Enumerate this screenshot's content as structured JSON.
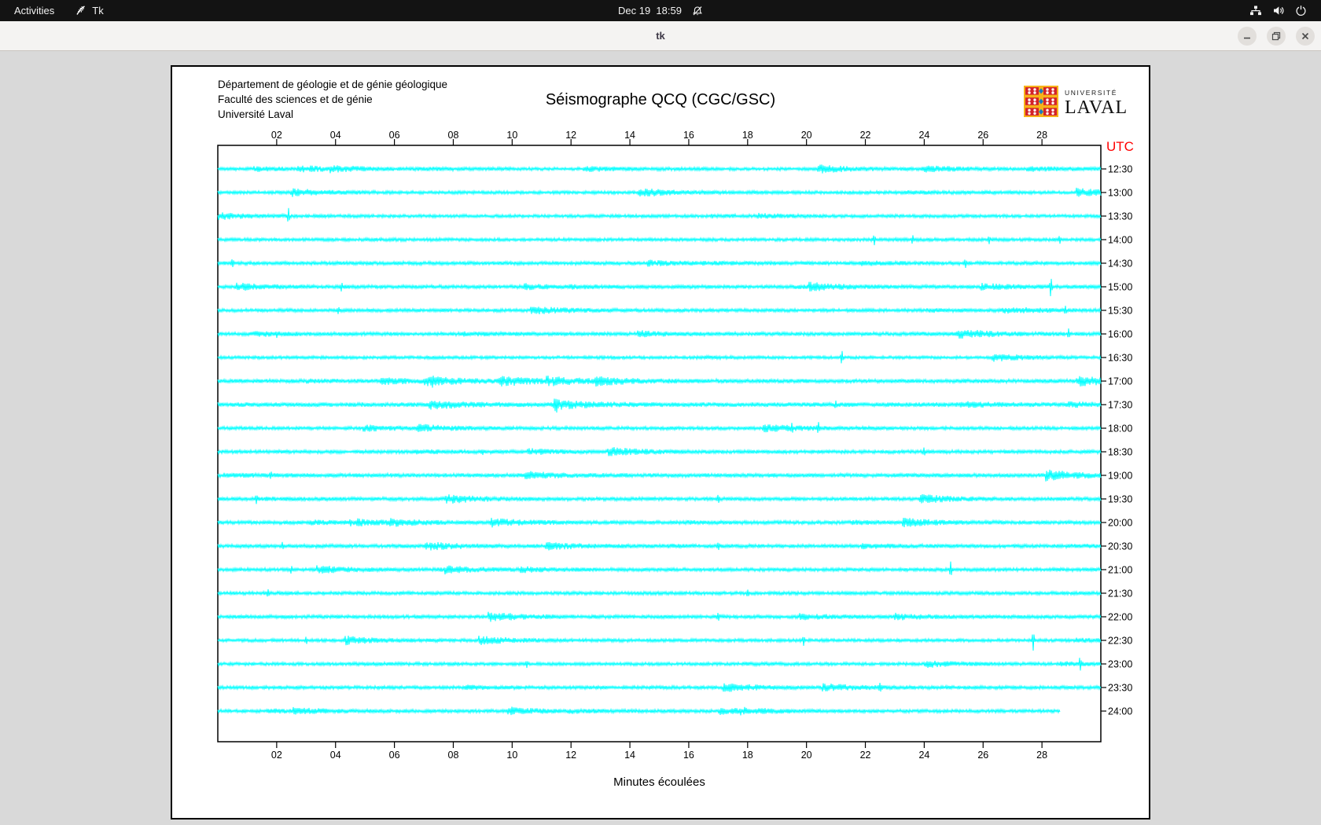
{
  "topbar": {
    "activities": "Activities",
    "app_name": "Tk",
    "clock": "Dec 19  18:59"
  },
  "titlebar": {
    "title": "tk",
    "buttons": [
      "minimize",
      "restore",
      "close"
    ]
  },
  "canvas": {
    "header_lines": [
      "Département de géologie et de génie géologique",
      "Faculté des sciences et de génie",
      "Université Laval"
    ],
    "title": "Séismographe QCQ (CGC/GSC)",
    "logo": {
      "univ": "UNIVERSITÉ",
      "name": "LAVAL",
      "red": "#d2232a",
      "yellow": "#f7b219",
      "blue": "#1f7bbf"
    }
  },
  "chart_data": {
    "type": "line",
    "title": "Séismographe QCQ (CGC/GSC)",
    "xlabel": "Minutes écoulées",
    "ylabel_right": "UTC",
    "x_range": [
      0,
      30
    ],
    "x_ticks": [
      "02",
      "04",
      "06",
      "08",
      "10",
      "12",
      "14",
      "16",
      "18",
      "20",
      "22",
      "24",
      "26",
      "28"
    ],
    "trace_color": "#00ffff",
    "utc_color": "#ff0000",
    "grid": false,
    "rows_note": "each row is a 30-minute helicorder trace labeled with its UTC end time; spikes = [minute, half_amplitude_px]",
    "rows": [
      {
        "label": "12:30",
        "amp": 1.8,
        "end_minute": 30,
        "spikes": []
      },
      {
        "label": "13:00",
        "amp": 1.8,
        "end_minute": 30,
        "spikes": []
      },
      {
        "label": "13:30",
        "amp": 1.8,
        "end_minute": 30,
        "spikes": [
          [
            2.4,
            10
          ]
        ]
      },
      {
        "label": "14:00",
        "amp": 1.8,
        "end_minute": 30,
        "spikes": [
          [
            22.3,
            6
          ],
          [
            23.6,
            5
          ],
          [
            26.2,
            4
          ],
          [
            28.6,
            4
          ]
        ]
      },
      {
        "label": "14:30",
        "amp": 2.0,
        "end_minute": 30,
        "spikes": [
          [
            0.5,
            4
          ],
          [
            25.4,
            5
          ]
        ]
      },
      {
        "label": "15:00",
        "amp": 2.0,
        "end_minute": 30,
        "spikes": [
          [
            4.2,
            4
          ],
          [
            28.3,
            12
          ]
        ]
      },
      {
        "label": "15:30",
        "amp": 1.9,
        "end_minute": 30,
        "spikes": [
          [
            4.1,
            4
          ],
          [
            28.8,
            4
          ]
        ]
      },
      {
        "label": "16:00",
        "amp": 2.0,
        "end_minute": 30,
        "spikes": [
          [
            2.0,
            3
          ],
          [
            28.9,
            5
          ]
        ]
      },
      {
        "label": "16:30",
        "amp": 1.7,
        "end_minute": 30,
        "spikes": [
          [
            21.2,
            8
          ]
        ]
      },
      {
        "label": "17:00",
        "amp": 2.2,
        "end_minute": 30,
        "spikes": [
          [
            7.3,
            4
          ]
        ]
      },
      {
        "label": "17:30",
        "amp": 2.4,
        "end_minute": 30,
        "spikes": [
          [
            11.5,
            4
          ],
          [
            21.0,
            4
          ]
        ]
      },
      {
        "label": "18:00",
        "amp": 1.9,
        "end_minute": 30,
        "spikes": [
          [
            19.5,
            4
          ],
          [
            20.4,
            6
          ]
        ]
      },
      {
        "label": "18:30",
        "amp": 2.0,
        "end_minute": 30,
        "spikes": [
          [
            9.0,
            3
          ],
          [
            24.0,
            4
          ]
        ]
      },
      {
        "label": "19:00",
        "amp": 2.2,
        "end_minute": 30,
        "spikes": [
          [
            1.8,
            4
          ]
        ]
      },
      {
        "label": "19:30",
        "amp": 2.0,
        "end_minute": 30,
        "spikes": [
          [
            1.3,
            4
          ],
          [
            17.0,
            4
          ]
        ]
      },
      {
        "label": "20:00",
        "amp": 2.0,
        "end_minute": 30,
        "spikes": [
          [
            4.5,
            3
          ]
        ]
      },
      {
        "label": "20:30",
        "amp": 2.1,
        "end_minute": 30,
        "spikes": [
          [
            2.2,
            4
          ],
          [
            17.0,
            4
          ]
        ]
      },
      {
        "label": "21:00",
        "amp": 1.9,
        "end_minute": 30,
        "spikes": [
          [
            2.5,
            4
          ],
          [
            24.9,
            9
          ]
        ]
      },
      {
        "label": "21:30",
        "amp": 1.9,
        "end_minute": 30,
        "spikes": [
          [
            1.7,
            4
          ],
          [
            18.0,
            4
          ]
        ]
      },
      {
        "label": "22:00",
        "amp": 2.0,
        "end_minute": 30,
        "spikes": [
          [
            17.0,
            4
          ]
        ]
      },
      {
        "label": "22:30",
        "amp": 1.8,
        "end_minute": 30,
        "spikes": [
          [
            3.0,
            4
          ],
          [
            19.9,
            6
          ],
          [
            27.7,
            12
          ]
        ]
      },
      {
        "label": "23:00",
        "amp": 1.8,
        "end_minute": 30,
        "spikes": [
          [
            10.5,
            3
          ],
          [
            29.3,
            8
          ]
        ]
      },
      {
        "label": "23:30",
        "amp": 1.9,
        "end_minute": 30,
        "spikes": [
          [
            22.5,
            5
          ]
        ]
      },
      {
        "label": "24:00",
        "amp": 1.9,
        "end_minute": 28.6,
        "spikes": []
      }
    ]
  }
}
